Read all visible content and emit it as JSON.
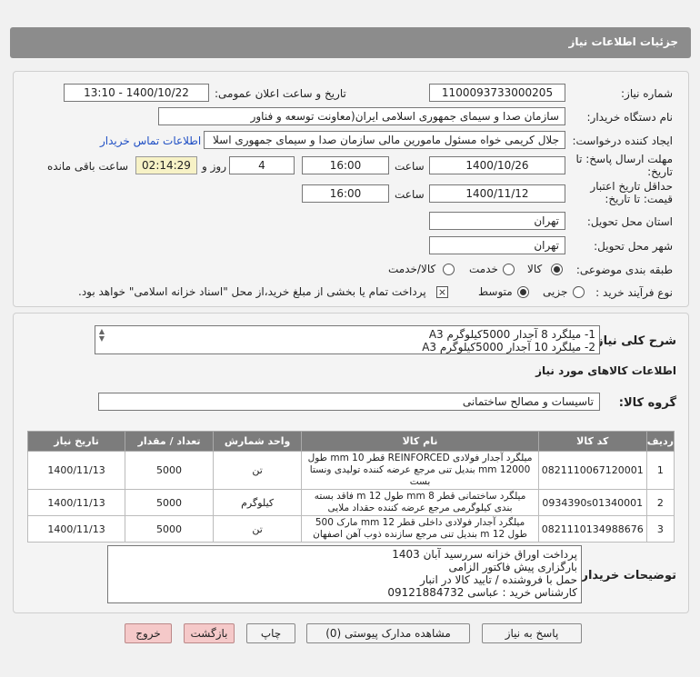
{
  "header": {
    "title": "جزئیات اطلاعات نیاز"
  },
  "form": {
    "need_number": {
      "label": "شماره نیاز:",
      "value": "1100093733000205"
    },
    "announce_datetime": {
      "label": "تاریخ و ساعت اعلان عمومی:",
      "value": "1400/10/22 - 13:10"
    },
    "buyer_org": {
      "label": "نام دستگاه خریدار:",
      "value": "سازمان صدا و سیمای جمهوری اسلامی ایران(معاونت توسعه و فناور"
    },
    "creator": {
      "label": "ایجاد کننده درخواست:",
      "value": "جلال کریمی خواه مسئول مامورین مالی  سازمان صدا و سیمای جمهوری اسلا",
      "contact_link": "اطلاعات تماس خریدار"
    },
    "response_deadline": {
      "label": "مهلت ارسال پاسخ: تا تاریخ:",
      "date": "1400/10/26",
      "time_label": "ساعت",
      "time": "16:00",
      "days": "4",
      "days_label": "روز و",
      "remaining": "02:14:29",
      "remaining_label": "ساعت باقی مانده"
    },
    "price_validity": {
      "label": "حداقل تاریخ اعتبار قیمت: تا تاریخ:",
      "date": "1400/11/12",
      "time_label": "ساعت",
      "time": "16:00"
    },
    "delivery_province": {
      "label": "استان محل تحویل:",
      "value": "تهران"
    },
    "delivery_city": {
      "label": "شهر محل تحویل:",
      "value": "تهران"
    },
    "category": {
      "label": "طبقه بندی موضوعی:",
      "options": [
        "کالا",
        "خدمت",
        "کالا/خدمت"
      ],
      "selected": "کالا"
    },
    "purchase_type": {
      "label": "نوع فرآیند خرید :",
      "options": [
        "جزیی",
        "متوسط"
      ],
      "selected": "متوسط",
      "note": "پرداخت تمام یا بخشی از مبلغ خرید،از محل \"اسناد خزانه اسلامی\" خواهد بود."
    }
  },
  "summary": {
    "label": "شرح کلی نیاز:",
    "lines": [
      "1- میلگرد 8 آجدار 5000کیلوگرم A3",
      "2- میلگرد 10 آجدار 5000کیلوگرم A3"
    ]
  },
  "goods_section": {
    "title": "اطلاعات کالاهای مورد نیاز"
  },
  "goods_group": {
    "label": "گروه کالا:",
    "value": "تاسیسات و مصالح ساختمانی"
  },
  "table": {
    "headers": [
      "ردیف",
      "کد کالا",
      "نام کالا",
      "واحد شمارش",
      "تعداد / مقدار",
      "تاریخ نیاز"
    ],
    "rows": [
      {
        "row": "1",
        "code": "0821110067120001",
        "name": "میلگرد آجدار فولادی REINFORCED قطر mm 10 طول 12000 mm بندیل تنی مرجع عرضه کننده تولیدی ونستا بست",
        "unit": "تن",
        "qty": "5000",
        "date": "1400/11/13"
      },
      {
        "row": "2",
        "code": "0934390s01340001",
        "name": "میلگرد ساختمانی قطر mm 8 طول m 12 فاقد بسته بندی کیلوگرمی مرجع عرضه کننده حقداد ملایی",
        "unit": "کیلوگرم",
        "qty": "5000",
        "date": "1400/11/13"
      },
      {
        "row": "3",
        "code": "0821110134988676",
        "name": "میلگرد آجدار فولادی داخلی قطر mm 12 مارک 500 طول m 12 بندیل تنی مرجع سازنده ذوب آهن اصفهان",
        "unit": "تن",
        "qty": "5000",
        "date": "1400/11/13"
      }
    ]
  },
  "buyer_notes": {
    "label": "توضیحات خریدار:",
    "lines": [
      "پرداخت اوراق خزانه سررسید آبان 1403",
      "بارگزاری پیش فاکتور الزامی",
      "حمل با فروشنده / تایید کالا در انبار",
      "کارشناس خرید : عباسی 09121884732"
    ]
  },
  "buttons": {
    "reply": "پاسخ به نیاز",
    "attachments": "مشاهده مدارک پیوستی (0)",
    "print": "چاپ",
    "back": "بازگشت",
    "exit": "خروج"
  },
  "colors": {
    "title_bar": "#8c8c8c",
    "table_header": "#7c7c7c",
    "link": "#1f4fc4",
    "remaining_bg": "#f7f2c6",
    "danger_btn": "#f5c9c9"
  }
}
